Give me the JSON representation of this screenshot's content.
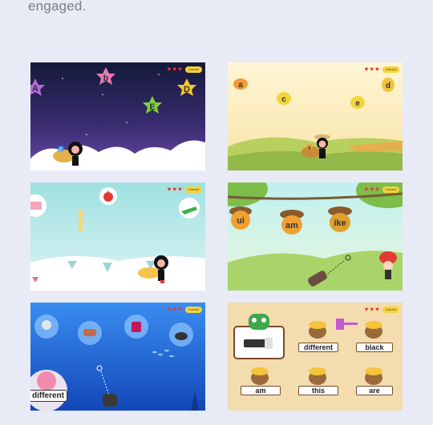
{
  "intro_text": "engaged.",
  "hud": {
    "correct_label": "Correct",
    "hearts": [
      "♥",
      "♥",
      "♥"
    ]
  },
  "tiles": [
    {
      "letters": [
        "A",
        "b",
        "C",
        "E",
        "D"
      ],
      "colors": [
        "#b06ad9",
        "#e87bb0",
        "#2b8be8",
        "#7fd43b",
        "#f7c82b"
      ]
    },
    {
      "letters": [
        "a",
        "c",
        "b",
        "e",
        "d"
      ]
    },
    {
      "items": [
        "cake",
        "apple",
        "crocodile"
      ]
    },
    {
      "words": [
        "ui",
        "am",
        "ike"
      ]
    },
    {
      "bubble_items": [
        "fan",
        "meat",
        "jam",
        "pan"
      ],
      "word": "different"
    },
    {
      "words": [
        "different",
        "black",
        "am",
        "this",
        "are"
      ]
    }
  ]
}
